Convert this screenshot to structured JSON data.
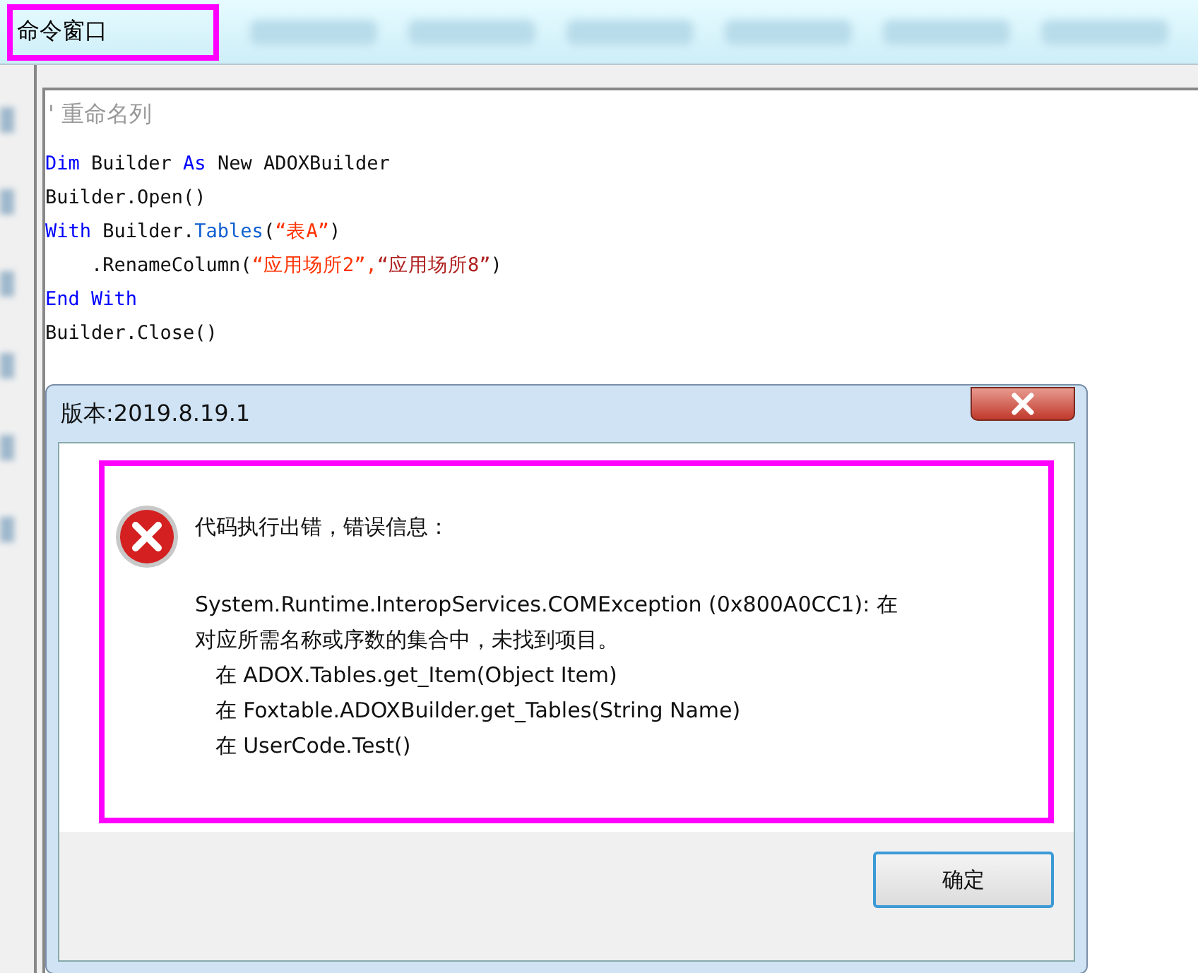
{
  "top_bar": {
    "label": "命令窗口"
  },
  "editor": {
    "comment": "'  重命名列",
    "lines": [
      [
        {
          "kind": "keyword",
          "text": "Dim"
        },
        {
          "kind": "plain",
          "text": " Builder "
        },
        {
          "kind": "keyword",
          "text": "As"
        },
        {
          "kind": "plain",
          "text": " New ADOXBuilder"
        }
      ],
      [
        {
          "kind": "plain",
          "text": "Builder.Open()"
        }
      ],
      [
        {
          "kind": "keyword",
          "text": "With"
        },
        {
          "kind": "plain",
          "text": " Builder."
        },
        {
          "kind": "member",
          "text": "Tables"
        },
        {
          "kind": "plain",
          "text": "("
        },
        {
          "kind": "string",
          "text": "“表A”"
        },
        {
          "kind": "plain",
          "text": ")"
        }
      ],
      [
        {
          "kind": "plain",
          "text": "    .RenameColumn("
        },
        {
          "kind": "string",
          "text": "“应用场所2”,"
        },
        {
          "kind": "string2",
          "text": "“应用场所8”"
        },
        {
          "kind": "plain",
          "text": ")"
        }
      ],
      [
        {
          "kind": "keyword",
          "text": "End With"
        }
      ],
      [
        {
          "kind": "plain",
          "text": "Builder.Close()"
        }
      ]
    ]
  },
  "dialog": {
    "title": "版本:2019.8.19.1",
    "heading": "代码执行出错，错误信息：",
    "message_lines": [
      "System.Runtime.InteropServices.COMException (0x800A0CC1): 在",
      "对应所需名称或序数的集合中，未找到项目。",
      "   在 ADOX.Tables.get_Item(Object Item)",
      "   在 Foxtable.ADOXBuilder.get_Tables(String Name)",
      "   在 UserCode.Test()"
    ],
    "ok_button": "确定"
  }
}
